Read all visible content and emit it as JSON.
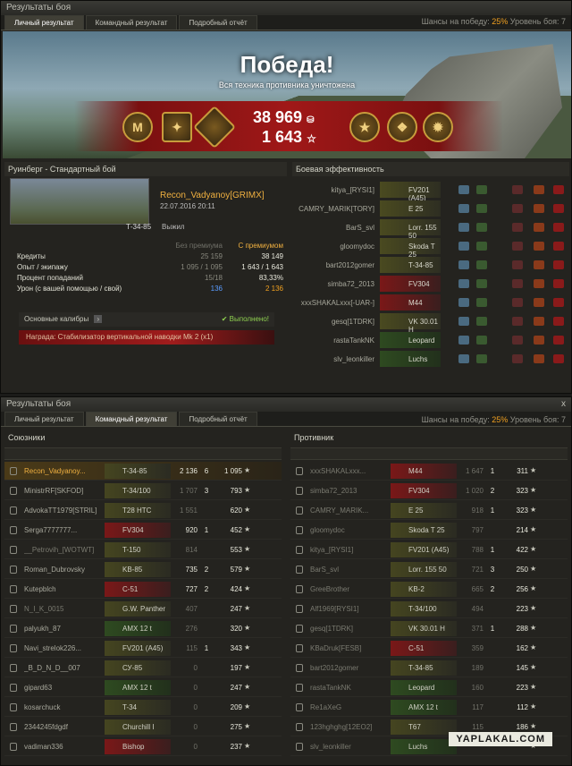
{
  "top": {
    "title": "Результаты боя",
    "tabs": [
      "Личный результат",
      "Командный результат",
      "Подробный отчёт"
    ],
    "chance_label": "Шансы на победу:",
    "chance_value": "25%",
    "level_label": "Уровень боя: 7",
    "victory": "Победа!",
    "victory_sub": "Вся техника противника уничтожена",
    "credits": "38 969",
    "exp": "1 643",
    "map_mode": "Руинберг - Стандартный бой",
    "efficiency_title": "Боевая эффективность",
    "player": "Recon_Vadyanoy[GRIMX]",
    "date": "22.07.2016 20:11",
    "tank": "Т-34-85",
    "status": "Выжил",
    "col_no_prem": "Без премиума",
    "col_prem": "С премиумом",
    "stats": [
      {
        "label": "Кредиты",
        "a": "25 159",
        "b": "38 149"
      },
      {
        "label": "Опыт / экипажу",
        "a": "1 095 / 1 095",
        "b": "1 643 / 1 643"
      },
      {
        "label": "Процент попаданий",
        "a": "15/18",
        "b": "83,33%"
      },
      {
        "label": "Урон (с вашей помощью / свой)",
        "a": "136",
        "b": "2 136"
      }
    ],
    "calibers": "Основные калибры",
    "calibers_done": "Выполнено!",
    "award_label": "Награда:",
    "award_value": "Стабилизатор вертикальной наводки Mk 2 (x1)",
    "eff_rows": [
      {
        "name": "kitya_[RYSI1]",
        "tank": "FV201 (A45)",
        "cls": ""
      },
      {
        "name": "CAMRY_MARIK[TORY]",
        "tank": "E 25",
        "cls": ""
      },
      {
        "name": "BarS_svl",
        "tank": "Lorr. 155 50",
        "cls": ""
      },
      {
        "name": "gloomydoc",
        "tank": "Skoda T 25",
        "cls": ""
      },
      {
        "name": "bart2012gomer",
        "tank": "T-34-85",
        "cls": ""
      },
      {
        "name": "simba72_2013",
        "tank": "FV304",
        "cls": "red"
      },
      {
        "name": "xxxSHAKALxxx[-UAR-]",
        "tank": "M44",
        "cls": "red"
      },
      {
        "name": "gesq[1TDRK]",
        "tank": "VK 30.01 H",
        "cls": ""
      },
      {
        "name": "rastaTankNK",
        "tank": "Leopard",
        "cls": "green"
      },
      {
        "name": "slv_leonkiller",
        "tank": "Luchs",
        "cls": "green"
      }
    ]
  },
  "bottom": {
    "title": "Результаты боя",
    "tabs": [
      "Личный результат",
      "Командный результат",
      "Подробный отчёт"
    ],
    "chance_label": "Шансы на победу:",
    "chance_value": "25%",
    "level_label": "Уровень боя: 7",
    "allies_title": "Союзники",
    "enemies_title": "Противник",
    "allies": [
      {
        "name": "Recon_Vadyanoy...",
        "tank": "T-34-85",
        "d": "2 136",
        "k": "6",
        "e": "1 095",
        "cls": "",
        "row": "me",
        "dhi": true
      },
      {
        "name": "MinistrRF[SKFOD]",
        "tank": "T-34/100",
        "d": "1 707",
        "k": "3",
        "e": "793",
        "cls": "",
        "row": "",
        "dhi": false
      },
      {
        "name": "AdvokaTT1979[STRIL]",
        "tank": "T28 HTC",
        "d": "1 551",
        "k": "",
        "e": "620",
        "cls": "",
        "row": "",
        "dhi": false
      },
      {
        "name": "Serga7777777...",
        "tank": "FV304",
        "d": "920",
        "k": "1",
        "e": "452",
        "cls": "red",
        "row": "",
        "dhi": true
      },
      {
        "name": "__Petrovih_[WOTWT]",
        "tank": "T-150",
        "d": "814",
        "k": "",
        "e": "553",
        "cls": "",
        "row": "dead",
        "dhi": false
      },
      {
        "name": "Roman_Dubrovsky",
        "tank": "KB-85",
        "d": "735",
        "k": "2",
        "e": "579",
        "cls": "",
        "row": "",
        "dhi": true
      },
      {
        "name": "Kutepblch",
        "tank": "C-51",
        "d": "727",
        "k": "2",
        "e": "424",
        "cls": "red",
        "row": "",
        "dhi": true
      },
      {
        "name": "N_I_K_0015",
        "tank": "G.W. Panther",
        "d": "407",
        "k": "",
        "e": "247",
        "cls": "",
        "row": "dead",
        "dhi": false
      },
      {
        "name": "palyukh_87",
        "tank": "AMX 12 t",
        "d": "276",
        "k": "",
        "e": "320",
        "cls": "green",
        "row": "",
        "dhi": false
      },
      {
        "name": "Navi_strelok226...",
        "tank": "FV201 (A45)",
        "d": "115",
        "k": "1",
        "e": "343",
        "cls": "",
        "row": "",
        "dhi": false
      },
      {
        "name": "_B_D_N_D__007",
        "tank": "СУ-85",
        "d": "0",
        "k": "",
        "e": "197",
        "cls": "",
        "row": "",
        "dhi": false
      },
      {
        "name": "gipard63",
        "tank": "AMX 12 t",
        "d": "0",
        "k": "",
        "e": "247",
        "cls": "green",
        "row": "",
        "dhi": false
      },
      {
        "name": "kosarchuck",
        "tank": "T-34",
        "d": "0",
        "k": "",
        "e": "209",
        "cls": "",
        "row": "",
        "dhi": false
      },
      {
        "name": "2344245fdgdf",
        "tank": "Churchill I",
        "d": "0",
        "k": "",
        "e": "275",
        "cls": "",
        "row": "",
        "dhi": false
      },
      {
        "name": "vadiman336",
        "tank": "Bishop",
        "d": "0",
        "k": "",
        "e": "237",
        "cls": "red",
        "row": "",
        "dhi": false
      }
    ],
    "enemies": [
      {
        "name": "xxxSHAKALxxx...",
        "tank": "M44",
        "d": "1 647",
        "k": "1",
        "e": "311",
        "cls": "red",
        "row": "dead"
      },
      {
        "name": "simba72_2013",
        "tank": "FV304",
        "d": "1 020",
        "k": "2",
        "e": "323",
        "cls": "red",
        "row": "dead"
      },
      {
        "name": "CAMRY_MARIK...",
        "tank": "E 25",
        "d": "918",
        "k": "1",
        "e": "323",
        "cls": "",
        "row": "dead"
      },
      {
        "name": "gloomydoc",
        "tank": "Skoda T 25",
        "d": "797",
        "k": "",
        "e": "214",
        "cls": "",
        "row": "dead"
      },
      {
        "name": "kitya_[RYSI1]",
        "tank": "FV201 (A45)",
        "d": "788",
        "k": "1",
        "e": "422",
        "cls": "",
        "row": "dead"
      },
      {
        "name": "BarS_svl",
        "tank": "Lorr. 155 50",
        "d": "721",
        "k": "3",
        "e": "250",
        "cls": "",
        "row": "dead"
      },
      {
        "name": "GreeBrother",
        "tank": "KB-2",
        "d": "665",
        "k": "2",
        "e": "256",
        "cls": "",
        "row": "dead"
      },
      {
        "name": "Alf1969[RYSI1]",
        "tank": "T-34/100",
        "d": "494",
        "k": "",
        "e": "223",
        "cls": "",
        "row": "dead"
      },
      {
        "name": "gesq[1TDRK]",
        "tank": "VK 30.01 H",
        "d": "371",
        "k": "1",
        "e": "288",
        "cls": "",
        "row": "dead"
      },
      {
        "name": "KBaDruk[FESB]",
        "tank": "C-51",
        "d": "359",
        "k": "",
        "e": "162",
        "cls": "red",
        "row": "dead"
      },
      {
        "name": "bart2012gomer",
        "tank": "T-34-85",
        "d": "189",
        "k": "",
        "e": "145",
        "cls": "",
        "row": "dead"
      },
      {
        "name": "rastaTankNK",
        "tank": "Leopard",
        "d": "160",
        "k": "",
        "e": "223",
        "cls": "green",
        "row": "dead"
      },
      {
        "name": "Re1aXeG",
        "tank": "AMX 12 t",
        "d": "117",
        "k": "",
        "e": "112",
        "cls": "green",
        "row": "dead"
      },
      {
        "name": "123hghghg[12EO2]",
        "tank": "T67",
        "d": "115",
        "k": "",
        "e": "186",
        "cls": "",
        "row": "dead"
      },
      {
        "name": "slv_leonkiller",
        "tank": "Luchs",
        "d": "",
        "k": "",
        "e": "",
        "cls": "green",
        "row": "dead"
      }
    ],
    "close": "x"
  },
  "watermark": "YAPLAKAL.COM"
}
